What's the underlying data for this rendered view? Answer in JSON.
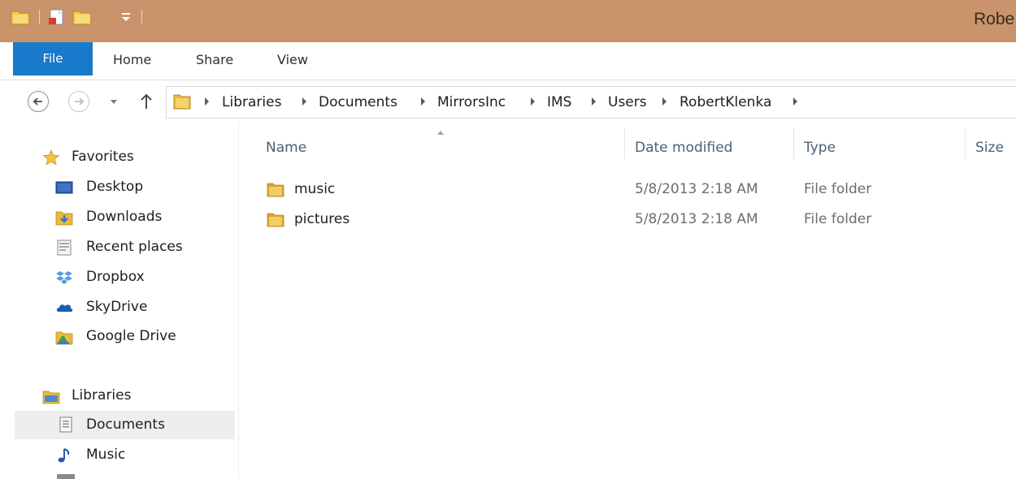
{
  "window": {
    "title": "Robe"
  },
  "ribbon": {
    "tabs": [
      {
        "label": "File"
      },
      {
        "label": "Home"
      },
      {
        "label": "Share"
      },
      {
        "label": "View"
      }
    ]
  },
  "address": {
    "breadcrumbs": [
      "Libraries",
      "Documents",
      "MirrorsInc",
      "IMS",
      "Users",
      "RobertKlenka"
    ]
  },
  "sidebar": {
    "favorites_label": "Favorites",
    "favorites": [
      {
        "label": "Desktop",
        "icon": "desktop-icon"
      },
      {
        "label": "Downloads",
        "icon": "downloads-folder-icon"
      },
      {
        "label": "Recent places",
        "icon": "recent-places-icon"
      },
      {
        "label": "Dropbox",
        "icon": "dropbox-icon"
      },
      {
        "label": "SkyDrive",
        "icon": "skydrive-icon"
      },
      {
        "label": "Google Drive",
        "icon": "google-drive-icon"
      }
    ],
    "libraries_label": "Libraries",
    "libraries": [
      {
        "label": "Documents",
        "icon": "documents-icon",
        "selected": true
      },
      {
        "label": "Music",
        "icon": "music-icon"
      }
    ]
  },
  "content": {
    "columns": [
      "Name",
      "Date modified",
      "Type",
      "Size"
    ],
    "sorted_column": "Name",
    "rows": [
      {
        "name": "music",
        "date": "5/8/2013 2:18 AM",
        "type": "File folder"
      },
      {
        "name": "pictures",
        "date": "5/8/2013 2:18 AM",
        "type": "File folder"
      }
    ]
  },
  "colors": {
    "titlebar": "#c9946b",
    "file_tab": "#1979ca",
    "selection": "#eeeeee",
    "header_text": "#4c607a",
    "folder": "#e8b93c"
  }
}
